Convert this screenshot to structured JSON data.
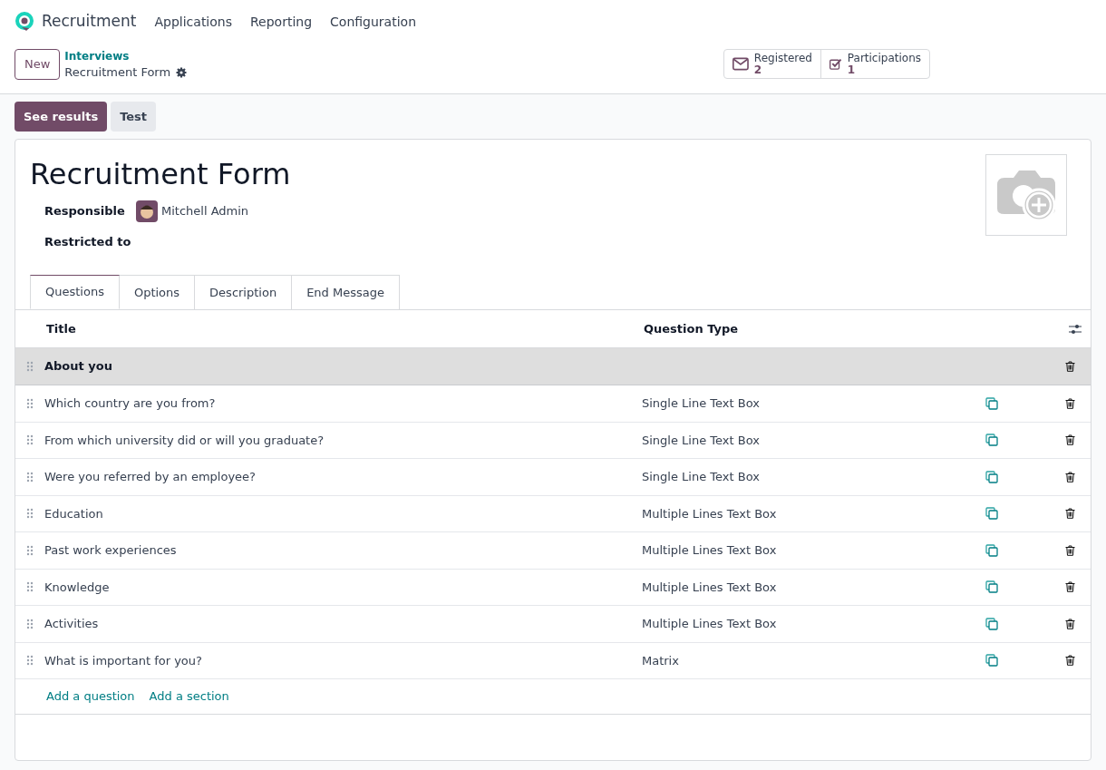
{
  "navbar": {
    "app": "Recruitment",
    "menu": [
      "Applications",
      "Reporting",
      "Configuration"
    ]
  },
  "control_panel": {
    "new_button": "New",
    "breadcrumb": "Interviews",
    "record": "Recruitment Form",
    "stats": [
      {
        "label": "Registered",
        "value": "2",
        "kind": "mail"
      },
      {
        "label": "Participations",
        "value": "1",
        "kind": "check"
      }
    ]
  },
  "actions": [
    {
      "label": "See results",
      "kind": "primary"
    },
    {
      "label": "Test",
      "kind": "secondary"
    }
  ],
  "form": {
    "title": "Recruitment Form",
    "fields": [
      {
        "label": "Responsible",
        "value": "Mitchell Admin"
      },
      {
        "label": "Restricted to"
      }
    ],
    "tabs": [
      {
        "label": "Questions",
        "selected": true
      },
      {
        "label": "Options",
        "selected": false
      },
      {
        "label": "Description",
        "selected": false
      },
      {
        "label": "End Message",
        "selected": false
      }
    ],
    "table": {
      "columns": [
        "Title",
        "Question Type"
      ],
      "rows": [
        {
          "kind": "section",
          "title": "About you"
        },
        {
          "kind": "question",
          "title": "Which country are you from?",
          "type": "Single Line Text Box"
        },
        {
          "kind": "question",
          "title": "From which university did or will you graduate?",
          "type": "Single Line Text Box"
        },
        {
          "kind": "question",
          "title": "Were you referred by an employee?",
          "type": "Single Line Text Box"
        },
        {
          "kind": "question",
          "title": "Education",
          "type": "Multiple Lines Text Box"
        },
        {
          "kind": "question",
          "title": "Past work experiences",
          "type": "Multiple Lines Text Box"
        },
        {
          "kind": "question",
          "title": "Knowledge",
          "type": "Multiple Lines Text Box"
        },
        {
          "kind": "question",
          "title": "Activities",
          "type": "Multiple Lines Text Box"
        },
        {
          "kind": "question",
          "title": "What is important for you?",
          "type": "Matrix"
        }
      ],
      "add_links": [
        "Add a question",
        "Add a section"
      ]
    }
  }
}
